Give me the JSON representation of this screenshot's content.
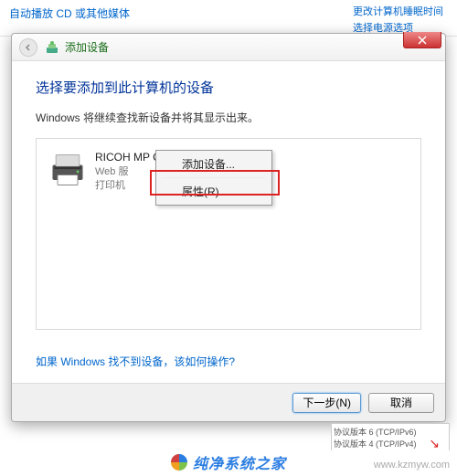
{
  "background": {
    "topLink": "自动播放 CD 或其他媒体",
    "rightLink1": "更改计算机睡眠时间",
    "rightLink2": "选择电源选项"
  },
  "window": {
    "title": "添加设备",
    "heading": "选择要添加到此计算机的设备",
    "subtext": "Windows 将继续查找新设备并将其显示出来。",
    "helpLink": "如果 Windows 找不到设备，该如何操作?",
    "nextBtn": "下一步(N)",
    "cancelBtn": "取消"
  },
  "device": {
    "name": "RICOH MP C3503",
    "line2": "Web 服",
    "line3": "打印机"
  },
  "contextMenu": {
    "item1": "添加设备...",
    "item2": "属性(R)"
  },
  "footer": {
    "line1": "协议版本 6 (TCP/IPv6)",
    "line2": "协议版本 4 (TCP/IPv4)"
  },
  "watermark": {
    "brand": "纯净系统之家",
    "url": "www.kzmyw.com"
  }
}
